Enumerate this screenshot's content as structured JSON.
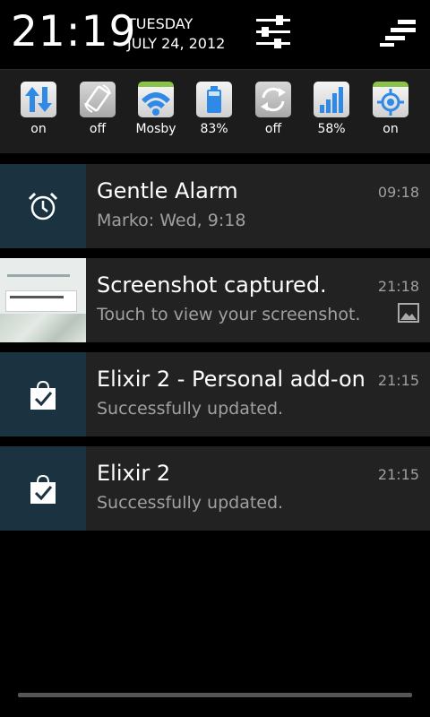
{
  "header": {
    "time": "21:19",
    "day": "TUESDAY",
    "date": "JULY 24, 2012"
  },
  "toggles": [
    {
      "label": "on",
      "icon": "data-transfer-icon"
    },
    {
      "label": "off",
      "icon": "auto-rotate-icon"
    },
    {
      "label": "Mosby",
      "icon": "wifi-icon"
    },
    {
      "label": "83%",
      "icon": "battery-icon"
    },
    {
      "label": "off",
      "icon": "sync-icon"
    },
    {
      "label": "58%",
      "icon": "signal-icon"
    },
    {
      "label": "on",
      "icon": "gps-icon"
    }
  ],
  "notifications": [
    {
      "title": "Gentle Alarm",
      "subtitle": "Marko: Wed, 9:18",
      "time": "09:18",
      "icon": "alarm-clock-icon"
    },
    {
      "title": "Screenshot captured.",
      "subtitle": "Touch to view your screenshot.",
      "time": "21:18",
      "icon": "image-icon"
    },
    {
      "title": "Elixir 2 - Personal add-on",
      "subtitle": "Successfully updated.",
      "time": "21:15",
      "icon": "shopping-bag-check-icon"
    },
    {
      "title": "Elixir 2",
      "subtitle": "Successfully updated.",
      "time": "21:15",
      "icon": "shopping-bag-check-icon"
    }
  ],
  "colors": {
    "accent_green": "#8bc34a",
    "accent_blue": "#2e8ae6",
    "notification_bg": "#222222",
    "thumb_bg": "#1b3340"
  }
}
